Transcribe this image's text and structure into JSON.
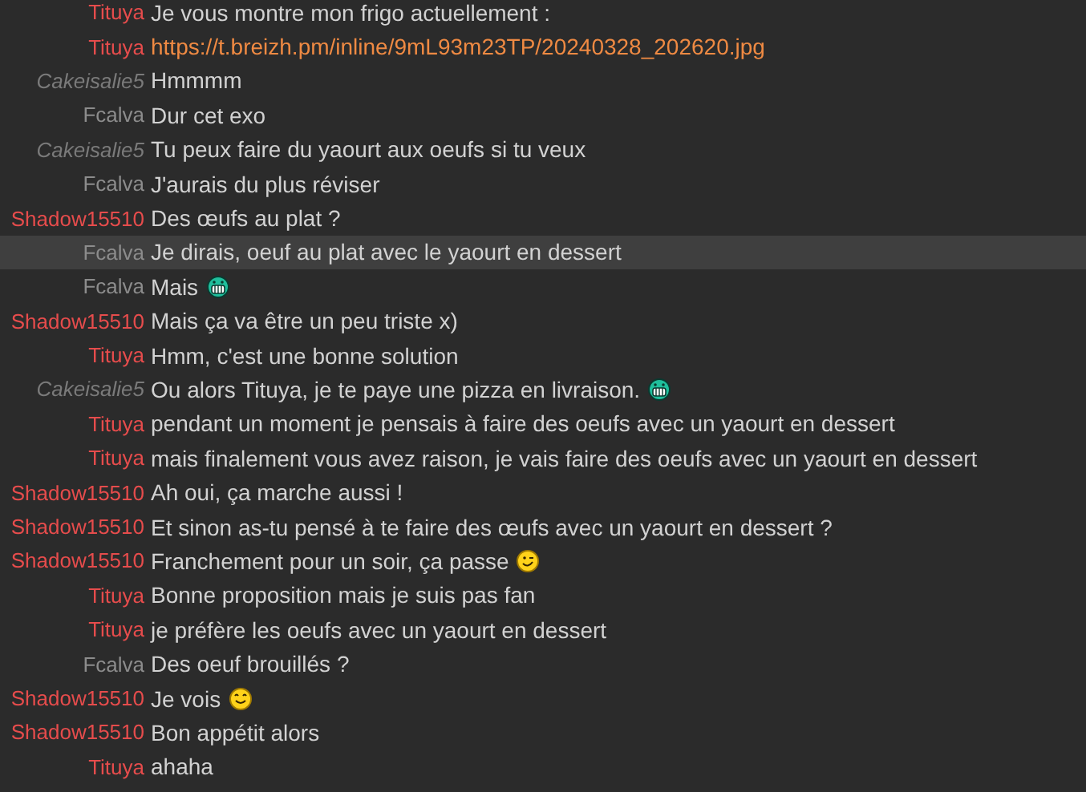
{
  "messages": [
    {
      "nick": "Tituya",
      "color": "#e64c4c",
      "italic": false,
      "kind": "text",
      "text": "Je vous montre mon frigo actuellement :",
      "selected": false
    },
    {
      "nick": "Tituya",
      "color": "#e64c4c",
      "italic": false,
      "kind": "link",
      "text": "https://t.breizh.pm/inline/9mL93m23TP/20240328_202620.jpg",
      "selected": false
    },
    {
      "nick": "Cakeisalie5",
      "color": "#7a7a7a",
      "italic": true,
      "kind": "text",
      "text": "Hmmmm",
      "selected": false
    },
    {
      "nick": "Fcalva",
      "color": "#8c8c8c",
      "italic": false,
      "kind": "text",
      "text": "Dur cet exo",
      "selected": false
    },
    {
      "nick": "Cakeisalie5",
      "color": "#7a7a7a",
      "italic": true,
      "kind": "text",
      "text": "Tu peux faire du yaourt aux oeufs si tu veux",
      "selected": false
    },
    {
      "nick": "Fcalva",
      "color": "#8c8c8c",
      "italic": false,
      "kind": "text",
      "text": "J'aurais du plus réviser",
      "selected": false
    },
    {
      "nick": "Shadow15510",
      "color": "#e64c4c",
      "italic": false,
      "kind": "text",
      "text": "Des œufs au plat ?",
      "selected": false
    },
    {
      "nick": "Fcalva",
      "color": "#8c8c8c",
      "italic": false,
      "kind": "text",
      "text": "Je dirais, oeuf au plat avec le yaourt en dessert",
      "selected": true
    },
    {
      "nick": "Fcalva",
      "color": "#8c8c8c",
      "italic": false,
      "kind": "text",
      "text": "Mais",
      "emoji": {
        "kind": "grin"
      },
      "selected": false
    },
    {
      "nick": "Shadow15510",
      "color": "#e64c4c",
      "italic": false,
      "kind": "text",
      "text": "Mais ça va être un peu triste x)",
      "selected": false
    },
    {
      "nick": "Tituya",
      "color": "#e64c4c",
      "italic": false,
      "kind": "text",
      "text": "Hmm, c'est une bonne solution",
      "selected": false
    },
    {
      "nick": "Cakeisalie5",
      "color": "#7a7a7a",
      "italic": true,
      "kind": "text",
      "text": "Ou alors Tituya, je te paye une pizza en livraison.",
      "emoji": {
        "kind": "grin"
      },
      "selected": false
    },
    {
      "nick": "Tituya",
      "color": "#e64c4c",
      "italic": false,
      "kind": "text",
      "text": "pendant un moment je pensais à faire des oeufs avec un yaourt en dessert",
      "selected": false
    },
    {
      "nick": "Tituya",
      "color": "#e64c4c",
      "italic": false,
      "kind": "text",
      "text": "mais finalement vous avez raison, je vais faire des oeufs avec un yaourt en dessert",
      "selected": false
    },
    {
      "nick": "Shadow15510",
      "color": "#e64c4c",
      "italic": false,
      "kind": "text",
      "text": "Ah oui, ça marche aussi !",
      "selected": false
    },
    {
      "nick": "Shadow15510",
      "color": "#e64c4c",
      "italic": false,
      "kind": "text",
      "text": "Et sinon as-tu pensé à te faire des œufs avec un yaourt en dessert ?",
      "selected": false
    },
    {
      "nick": "Shadow15510",
      "color": "#e64c4c",
      "italic": false,
      "kind": "text",
      "text": "Franchement pour un soir, ça passe",
      "emoji": {
        "kind": "wink"
      },
      "selected": false
    },
    {
      "nick": "Tituya",
      "color": "#e64c4c",
      "italic": false,
      "kind": "text",
      "text": "Bonne proposition mais je suis pas fan",
      "selected": false
    },
    {
      "nick": "Tituya",
      "color": "#e64c4c",
      "italic": false,
      "kind": "text",
      "text": "je préfère les oeufs avec un yaourt en dessert",
      "selected": false
    },
    {
      "nick": "Fcalva",
      "color": "#8c8c8c",
      "italic": false,
      "kind": "text",
      "text": "Des oeuf brouillés ?",
      "selected": false
    },
    {
      "nick": "Shadow15510",
      "color": "#e64c4c",
      "italic": false,
      "kind": "text",
      "text": "Je vois",
      "emoji": {
        "kind": "smile"
      },
      "selected": false
    },
    {
      "nick": "Shadow15510",
      "color": "#e64c4c",
      "italic": false,
      "kind": "text",
      "text": "Bon appétit alors",
      "selected": false
    },
    {
      "nick": "Tituya",
      "color": "#e64c4c",
      "italic": false,
      "kind": "text",
      "text": "ahaha",
      "selected": false
    }
  ]
}
